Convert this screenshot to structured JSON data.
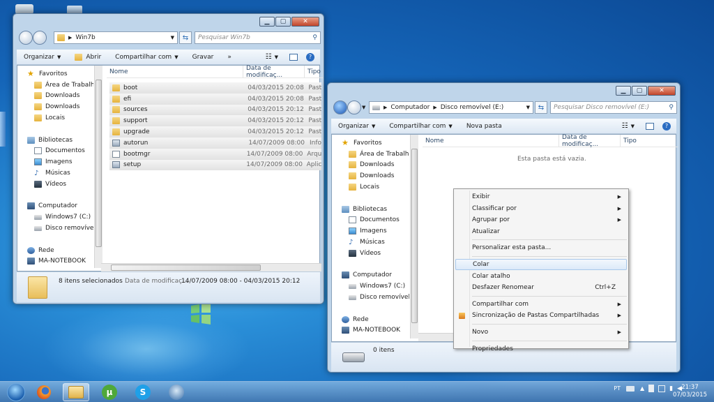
{
  "window1": {
    "address_crumb": "Win7b",
    "search_placeholder": "Pesquisar Win7b",
    "toolbar": {
      "organize": "Organizar",
      "open": "Abrir",
      "share": "Compartilhar com",
      "burn": "Gravar",
      "more": "»"
    },
    "nav": [
      {
        "type": "star",
        "label": "Favoritos"
      },
      {
        "type": "folder",
        "label": "Área de Trabalho"
      },
      {
        "type": "folder",
        "label": "Downloads"
      },
      {
        "type": "folder",
        "label": "Downloads"
      },
      {
        "type": "folder",
        "label": "Locais"
      },
      {
        "type": "gap",
        "label": ""
      },
      {
        "type": "lib",
        "label": "Bibliotecas"
      },
      {
        "type": "doc",
        "label": "Documentos"
      },
      {
        "type": "img",
        "label": "Imagens"
      },
      {
        "type": "music",
        "label": "Músicas"
      },
      {
        "type": "video",
        "label": "Vídeos"
      },
      {
        "type": "gap",
        "label": ""
      },
      {
        "type": "pc",
        "label": "Computador"
      },
      {
        "type": "drive",
        "label": "Windows7 (C:)"
      },
      {
        "type": "drive",
        "label": "Disco removível ("
      },
      {
        "type": "gap",
        "label": ""
      },
      {
        "type": "net",
        "label": "Rede"
      },
      {
        "type": "pc",
        "label": "MA-NOTEBOOK"
      }
    ],
    "columns": {
      "name": "Nome",
      "date": "Data de modificaç...",
      "type": "Tipo"
    },
    "files": [
      {
        "name": "boot",
        "date": "04/03/2015 20:08",
        "type": "Past",
        "icon": "folder"
      },
      {
        "name": "efi",
        "date": "04/03/2015 20:08",
        "type": "Past",
        "icon": "folder"
      },
      {
        "name": "sources",
        "date": "04/03/2015 20:12",
        "type": "Past",
        "icon": "folder"
      },
      {
        "name": "support",
        "date": "04/03/2015 20:12",
        "type": "Past",
        "icon": "folder"
      },
      {
        "name": "upgrade",
        "date": "04/03/2015 20:12",
        "type": "Past",
        "icon": "folder"
      },
      {
        "name": "autorun",
        "date": "14/07/2009 08:00",
        "type": "Info",
        "icon": "exe"
      },
      {
        "name": "bootmgr",
        "date": "14/07/2009 08:00",
        "type": "Arqu",
        "icon": "doc"
      },
      {
        "name": "setup",
        "date": "14/07/2009 08:00",
        "type": "Aplic",
        "icon": "exe"
      }
    ],
    "status": {
      "count": "8 itens selecionados",
      "date_label": "Data de modificaç...",
      "date_range": "14/07/2009 08:00 - 04/03/2015 20:12"
    }
  },
  "window2": {
    "address_crumbs": [
      "Computador",
      "Disco removível (E:)"
    ],
    "search_placeholder": "Pesquisar Disco removível (E:)",
    "toolbar": {
      "organize": "Organizar",
      "share": "Compartilhar com",
      "new_folder": "Nova pasta"
    },
    "nav": [
      {
        "type": "star",
        "label": "Favoritos"
      },
      {
        "type": "folder",
        "label": "Área de Trabalho"
      },
      {
        "type": "folder",
        "label": "Downloads"
      },
      {
        "type": "folder",
        "label": "Downloads"
      },
      {
        "type": "folder",
        "label": "Locais"
      },
      {
        "type": "gap",
        "label": ""
      },
      {
        "type": "lib",
        "label": "Bibliotecas"
      },
      {
        "type": "doc",
        "label": "Documentos"
      },
      {
        "type": "img",
        "label": "Imagens"
      },
      {
        "type": "music",
        "label": "Músicas"
      },
      {
        "type": "video",
        "label": "Vídeos"
      },
      {
        "type": "gap",
        "label": ""
      },
      {
        "type": "pc",
        "label": "Computador"
      },
      {
        "type": "drive",
        "label": "Windows7 (C:)"
      },
      {
        "type": "drive",
        "label": "Disco removível ("
      },
      {
        "type": "gap",
        "label": ""
      },
      {
        "type": "net",
        "label": "Rede"
      },
      {
        "type": "pc",
        "label": "MA-NOTEBOOK"
      }
    ],
    "columns": {
      "name": "Nome",
      "date": "Data de modificaç...",
      "type": "Tipo"
    },
    "empty_message": "Esta pasta está vazia.",
    "status": {
      "count": "0 itens"
    }
  },
  "context_menu": {
    "items": [
      {
        "label": "Exibir",
        "submenu": true
      },
      {
        "label": "Classificar por",
        "submenu": true
      },
      {
        "label": "Agrupar por",
        "submenu": true
      },
      {
        "label": "Atualizar"
      },
      {
        "sep": true
      },
      {
        "label": "Personalizar esta pasta..."
      },
      {
        "sep": true
      },
      {
        "label": "Colar",
        "highlight": true
      },
      {
        "label": "Colar atalho"
      },
      {
        "label": "Desfazer Renomear",
        "shortcut": "Ctrl+Z"
      },
      {
        "sep": true
      },
      {
        "label": "Compartilhar com",
        "submenu": true
      },
      {
        "label": "Sincronização de Pastas Compartilhadas",
        "submenu": true,
        "icon": true
      },
      {
        "sep": true
      },
      {
        "label": "Novo",
        "submenu": true
      },
      {
        "sep": true
      },
      {
        "label": "Propriedades"
      }
    ]
  },
  "taskbar": {
    "lang": "PT",
    "time": "21:37",
    "date": "07/03/2015",
    "apps": [
      "start-orb",
      "firefox-icon",
      "explorer-icon",
      "utorrent-icon",
      "skype-icon",
      "thunderbird-icon"
    ]
  },
  "colors": {
    "selection": "#e4e4e4",
    "accent": "#1a56b4",
    "menu_highlight": "#dceaf9"
  }
}
